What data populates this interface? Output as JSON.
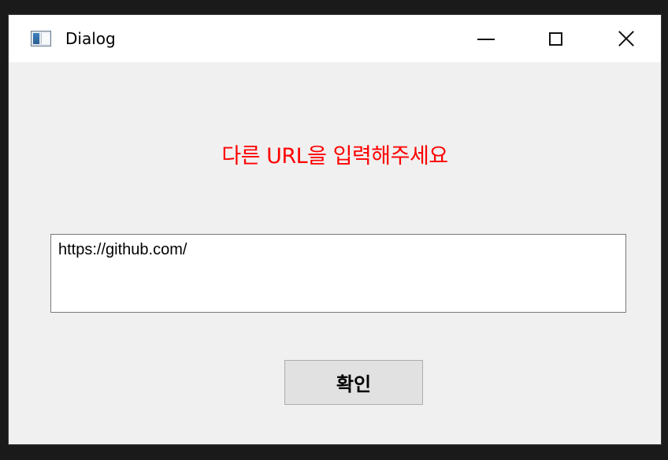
{
  "window": {
    "title": "Dialog",
    "icon": "app-window-icon",
    "controls": {
      "minimize_icon": "minimize-icon",
      "maximize_icon": "maximize-icon",
      "close_icon": "close-icon"
    }
  },
  "dialog": {
    "message": "다른 URL을 입력해주세요",
    "message_color": "#ff0000",
    "url_value": "https://github.com/",
    "confirm_label": "확인"
  }
}
